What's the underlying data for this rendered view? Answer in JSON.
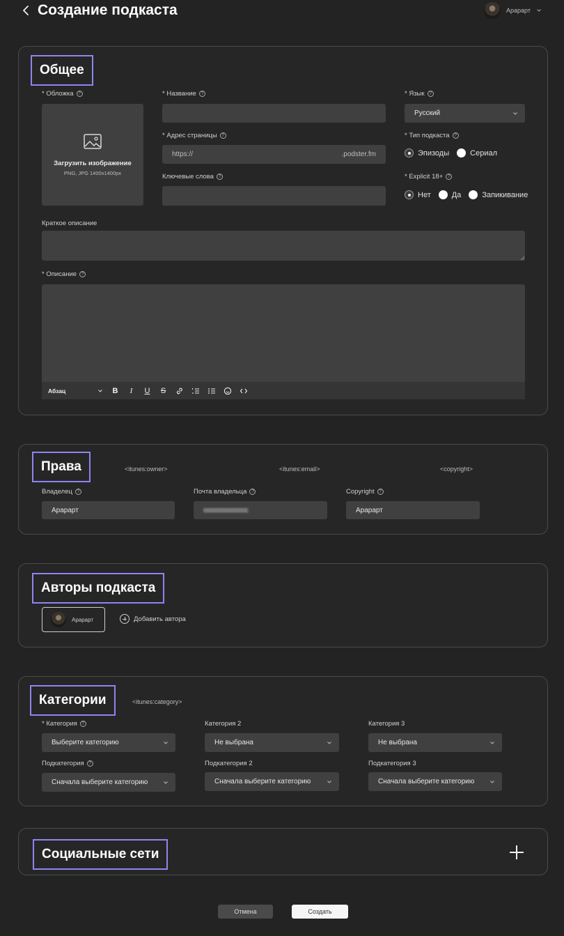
{
  "header": {
    "title": "Создание подкаста",
    "user_name": "Арарарт"
  },
  "general": {
    "title": "Общее",
    "cover": {
      "label": "* Обложка",
      "upload_title": "Загрузить изображение",
      "upload_hint": "PNG, JPG 1400x1400px"
    },
    "name": {
      "label": "* Название",
      "value": ""
    },
    "address": {
      "label": "* Адрес страницы",
      "prefix": "https://",
      "suffix": ".podster.fm"
    },
    "keywords": {
      "label": "Ключевые слова",
      "value": ""
    },
    "language": {
      "label": "* Язык",
      "value": "Русский"
    },
    "podcast_type": {
      "label": "* Тип подкаста",
      "options": [
        "Эпизоды",
        "Сериал"
      ],
      "selected": "Эпизоды"
    },
    "explicit": {
      "label": "* Explicit 18+",
      "options": [
        "Нет",
        "Да",
        "Запикивание"
      ],
      "selected": "Нет"
    },
    "short_description": {
      "label": "Краткое описание",
      "value": ""
    },
    "description": {
      "label": "* Описание",
      "format": "Абзац"
    }
  },
  "rights": {
    "title": "Права",
    "tags": [
      "<itunes:owner>",
      "<itunes:email>",
      "<copyright>"
    ],
    "owner": {
      "label": "Владелец",
      "value": "Арарарт"
    },
    "email": {
      "label": "Почта владельца",
      "value": "cccccccccccccccc"
    },
    "copyright": {
      "label": "Copyright",
      "value": "Арарарт"
    }
  },
  "authors": {
    "title": "Авторы подкаста",
    "items": [
      {
        "name": "Арарарт"
      }
    ],
    "add_label": "Добавить автора"
  },
  "categories": {
    "title": "Категории",
    "tag": "<itunes:category>",
    "category1": {
      "label": "* Категория",
      "value": "Выберите категорию"
    },
    "category2": {
      "label": "Категория 2",
      "value": "Не выбрана"
    },
    "category3": {
      "label": "Категория 3",
      "value": "Не выбрана"
    },
    "subcategory1": {
      "label": "Подкатегория",
      "value": "Сначала выберите категорию"
    },
    "subcategory2": {
      "label": "Подкатегория 2",
      "value": "Сначала выберите категорию"
    },
    "subcategory3": {
      "label": "Подкатегория 3",
      "value": "Сначала выберите категорию"
    }
  },
  "social": {
    "title": "Социальные сети"
  },
  "footer": {
    "cancel_label": "Отмена",
    "create_label": "Создать"
  },
  "icons": {
    "help": "?",
    "dropdown": "chevron-down-icon",
    "back": "chevron-left-icon",
    "image": "image-icon",
    "add": "plus-icon"
  },
  "colors": {
    "background": "#232323",
    "card": "#262626",
    "field": "#404040",
    "highlight_border": "#8e85f2",
    "primary_button": "#f6f6f6"
  }
}
